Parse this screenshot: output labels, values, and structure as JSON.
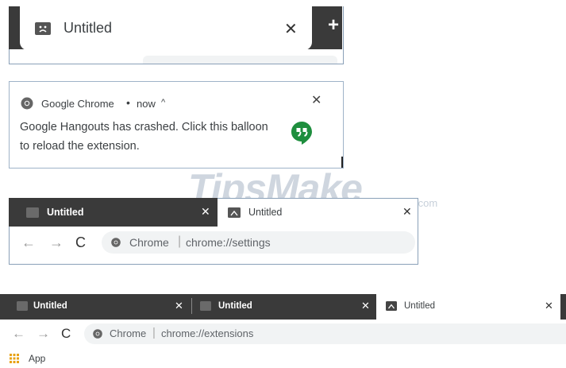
{
  "panel1": {
    "tab_title": "Untitled",
    "close_symbol": "✕",
    "new_tab_symbol": "+",
    "tab_icon": "sad-folder-icon"
  },
  "panel2": {
    "app_name": "Google Chrome",
    "dot": "•",
    "time": "now",
    "caret": "^",
    "close_symbol": "✕",
    "message": "Google Hangouts has crashed. Click this balloon to reload the extension.",
    "hangouts_icon": "hangouts-icon",
    "hangouts_color": "#1e8e3e"
  },
  "watermark": {
    "text": "TipsMake",
    "suffix": ".com"
  },
  "panel3": {
    "tab1_title": "Untitled",
    "tab2_title": "Untitled",
    "close_symbol": "✕",
    "back_symbol": "←",
    "forward_symbol": "→",
    "reload_symbol": "C",
    "omni_label": "Chrome",
    "separator": "|",
    "url": "chrome://settings"
  },
  "panel4": {
    "tab1_title": "Untitled",
    "tab2_title": "Untitled",
    "tab3_title": "Untitled",
    "close_symbol": "✕",
    "back_symbol": "←",
    "forward_symbol": "→",
    "reload_symbol": "C",
    "omni_label": "Chrome",
    "separator": "|",
    "url": "chrome://extensions",
    "bookmark_label": "App",
    "apps_icon_color": "#e8a317"
  },
  "colors": {
    "tab_strip_dark": "#3a3a3a",
    "omnibox_bg": "#f1f3f4",
    "panel_border": "#8aa0b8"
  }
}
